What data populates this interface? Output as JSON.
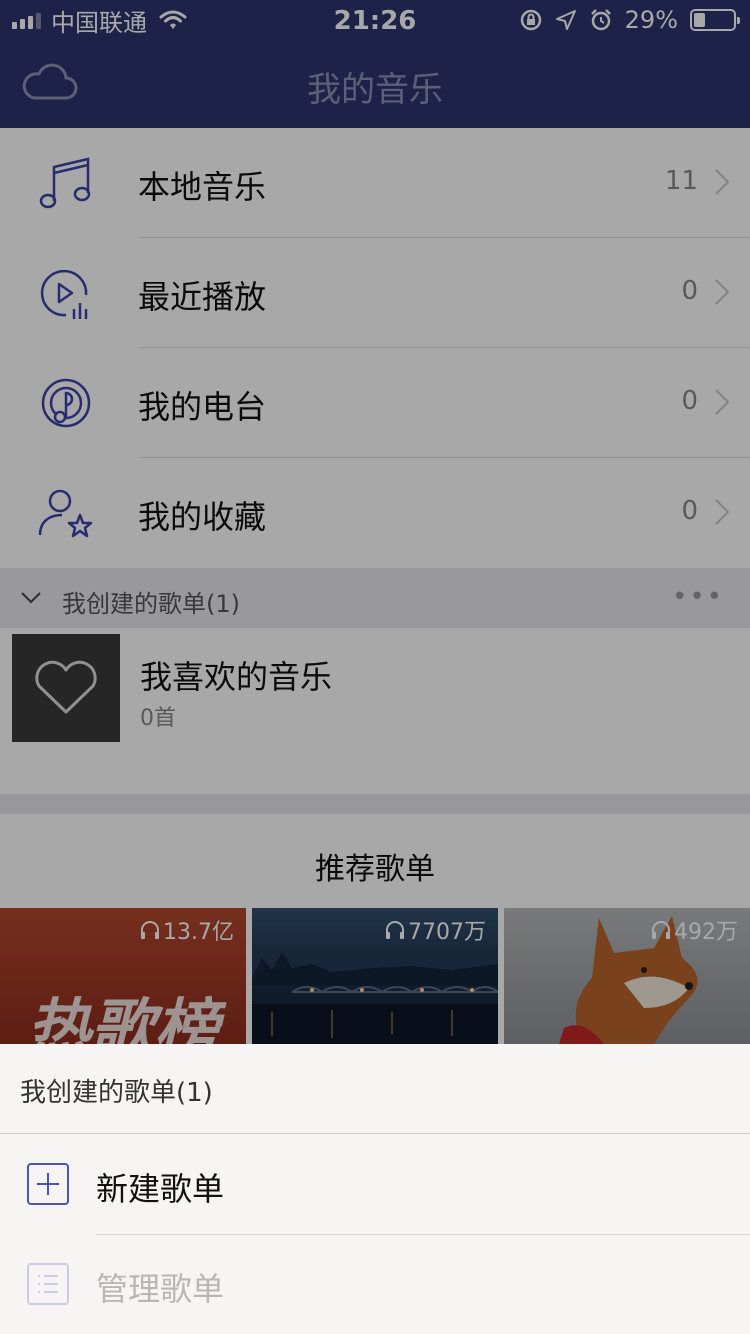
{
  "status_bar": {
    "carrier": "中国联通",
    "time": "21:26",
    "battery_percent": "29%"
  },
  "nav": {
    "title": "我的音乐",
    "left_icon": "cloud-icon"
  },
  "menu": [
    {
      "label": "本地音乐",
      "count": "11",
      "icon": "music-note-icon"
    },
    {
      "label": "最近播放",
      "count": "0",
      "icon": "recent-play-icon"
    },
    {
      "label": "我的电台",
      "count": "0",
      "icon": "radio-icon"
    },
    {
      "label": "我的收藏",
      "count": "0",
      "icon": "favorite-user-icon"
    }
  ],
  "section": {
    "label": "我创建的歌单(1)",
    "more": "•••"
  },
  "playlist": {
    "name": "我喜欢的音乐",
    "count": "0首"
  },
  "recommend": {
    "title": "推荐歌单",
    "cards": [
      {
        "plays": "13.7亿",
        "text": "热歌榜"
      },
      {
        "plays": "7707万"
      },
      {
        "plays": "492万"
      }
    ]
  },
  "sheet": {
    "title": "我创建的歌单(1)",
    "items": [
      {
        "label": "新建歌单",
        "icon": "plus-icon"
      },
      {
        "label": "管理歌单",
        "icon": "list-manage-icon"
      }
    ]
  },
  "colors": {
    "nav_bg": "#2e3570",
    "icon_accent": "#3c44a8",
    "overlay": "rgba(0,0,0,0.34)"
  }
}
